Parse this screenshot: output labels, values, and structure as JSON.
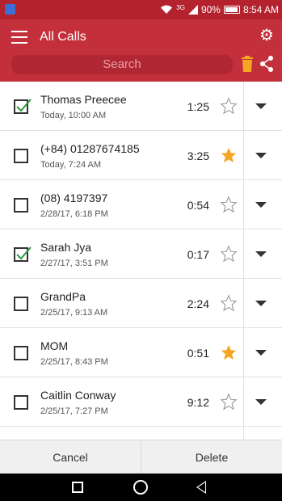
{
  "status": {
    "network": "3G",
    "battery": "90%",
    "time": "8:54 AM"
  },
  "header": {
    "title": "All Calls",
    "search_placeholder": "Search"
  },
  "calls": [
    {
      "name": "Thomas Preecee",
      "date": "Today, 10:00 AM",
      "duration": "1:25",
      "checked": true,
      "starred": false
    },
    {
      "name": "(+84) 01287674185",
      "date": "Today, 7:24 AM",
      "duration": "3:25",
      "checked": false,
      "starred": true
    },
    {
      "name": "(08) 4197397",
      "date": "2/28/17, 6:18 PM",
      "duration": "0:54",
      "checked": false,
      "starred": false
    },
    {
      "name": "Sarah Jya",
      "date": "2/27/17, 3:51 PM",
      "duration": "0:17",
      "checked": true,
      "starred": false
    },
    {
      "name": "GrandPa",
      "date": "2/25/17, 9:13 AM",
      "duration": "2:24",
      "checked": false,
      "starred": false
    },
    {
      "name": "MOM",
      "date": "2/25/17, 8:43 PM",
      "duration": "0:51",
      "checked": false,
      "starred": true
    },
    {
      "name": "Caitlin Conway",
      "date": "2/25/17, 7:27 PM",
      "duration": "9:12",
      "checked": false,
      "starred": false
    }
  ],
  "footer": {
    "cancel_label": "Cancel",
    "delete_label": "Delete"
  },
  "colors": {
    "accent": "#c3303b",
    "star": "#f5a623",
    "check": "#2e9b3e"
  }
}
